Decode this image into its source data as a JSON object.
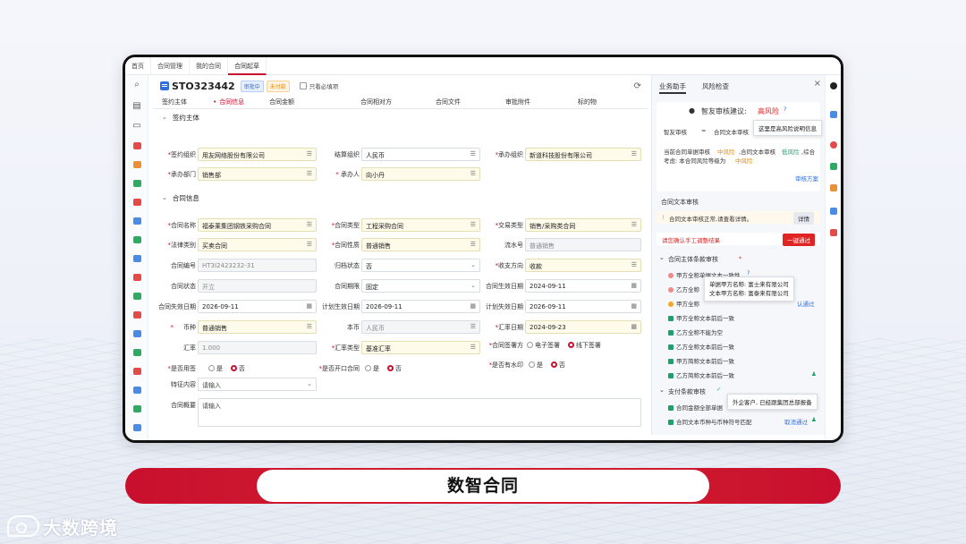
{
  "topnav": [
    "首页",
    "合同管理",
    "我的合同",
    "合同起草"
  ],
  "record": {
    "no": "STO323442",
    "badge1": "审批中",
    "badge2": "未付款",
    "only_required": "只看必填项"
  },
  "tabs": [
    "签约主体",
    "合同信息",
    "合同金额",
    "合同相对方",
    "合同文件",
    "审批附件",
    "标的物"
  ],
  "sections": {
    "party": "签约主体",
    "info": "合同信息"
  },
  "party_fields": [
    {
      "label": "签约组织",
      "value": "用友网络股份有限公司",
      "req": true
    },
    {
      "label": "结算组织",
      "value": "人民币",
      "req": false
    },
    {
      "label": "承办组织",
      "value": "新道科技股份有限公司",
      "req": true
    },
    {
      "label": "承办部门",
      "value": "销售部",
      "req": true
    },
    {
      "label": "承办人",
      "value": "向小丹",
      "req": true
    }
  ],
  "info_fields": [
    {
      "label": "合同名称",
      "value": "福泰莱集团钢铁采购合同",
      "req": true
    },
    {
      "label": "合同类型",
      "value": "工程采购合同",
      "req": true
    },
    {
      "label": "交易类型",
      "value": "销售/采购类合同",
      "req": true
    },
    {
      "label": "法律类别",
      "value": "买卖合同",
      "req": true
    },
    {
      "label": "合同性质",
      "value": "普通销售",
      "req": true
    },
    {
      "label": "流水号",
      "value": "普通销售",
      "req": false
    },
    {
      "label": "合同编号",
      "value": "HT3I2423232-31",
      "req": false
    },
    {
      "label": "归档状态",
      "value": "否",
      "req": false
    },
    {
      "label": "收支方向",
      "value": "收款",
      "req": true
    },
    {
      "label": "合同状态",
      "value": "开立",
      "req": false
    },
    {
      "label": "合同期限",
      "value": "固定",
      "req": false
    },
    {
      "label": "合同生效日期",
      "value": "2024-09-11",
      "req": false
    },
    {
      "label": "合同失效日期",
      "value": "2026-09-11",
      "req": false
    },
    {
      "label": "计划生效日期",
      "value": "2026-09-11",
      "req": false
    },
    {
      "label": "计划失效日期",
      "value": "2026-09-11",
      "req": false
    },
    {
      "label": "币种",
      "value": "普通销售",
      "req": true
    },
    {
      "label": "本币",
      "value": "人民币",
      "req": false
    },
    {
      "label": "汇率日期",
      "value": "2024-09-23",
      "req": true
    },
    {
      "label": "汇率",
      "value": "1.000",
      "req": false
    },
    {
      "label": "汇率类型",
      "value": "基准汇率",
      "req": true
    },
    {
      "label": "合同签署方",
      "value": "",
      "req": true
    },
    {
      "label": "是否用签",
      "value": "",
      "req": true
    },
    {
      "label": "是否开口合同",
      "value": "",
      "req": true
    },
    {
      "label": "是否有水印",
      "value": "",
      "req": true
    },
    {
      "label": "特征内容",
      "value": "请输入",
      "req": false
    },
    {
      "label": "合同概要",
      "value": "请输入",
      "req": false
    }
  ],
  "radios": {
    "sign_e": "电子签署",
    "sign_off": "线下签署",
    "yes": "是",
    "no": "否"
  },
  "right": {
    "tab1": "业务助手",
    "tab2": "风险检查",
    "ai_title": "智友审核建议:",
    "risk_level": "高风险",
    "review_label": "智友审核",
    "equals": "=",
    "text_review_label": "合同文本审核",
    "tooltip_reason": "这里是高风险说明信息",
    "summary_1": "当前合同单据审核",
    "summary_1_risk": "中风险",
    "summary_1b": ",合同文本审核",
    "summary_1_risk2": "低风险",
    "summary_1c": ",综合",
    "summary_2": "考虑: 本合同风险等级为",
    "summary_2_risk": "中风险",
    "review_plan": "审核方案",
    "text_section": "合同文本审核",
    "text_ok": "合同文本审核正常,请查看详情。",
    "detail_btn": "详情",
    "confirm_note": "请您确认手工调整结果",
    "pass_all_btn": "一键通过",
    "main_clause": "合同主体条款审核",
    "items": [
      "甲方全称单据文本一致性",
      "乙方全称",
      "甲方全称",
      "甲方全称文本前后一致",
      "乙方全称不能为空",
      "乙方全称文本前后一致",
      "甲方简称文本前后一致",
      "乙方简称文本前后一致"
    ],
    "tip_party_a": "单据甲方名称: 富士来有限公司",
    "tip_party_b": "文本甲方名称: 富泰来有限公司",
    "confirm_pass": "认通过",
    "pay_clause": "支付条款审核",
    "pay_items": [
      "合同金额全部单据",
      "合同文本币种与币种符号匹配"
    ],
    "tip_pay": "外企客户, 已经跟集团总部报备",
    "cancel_pass": "取消通过"
  },
  "banner": "数智合同",
  "logo": "大数跨境",
  "colors": {
    "brand_red": "#c8102e",
    "accent_blue": "#2f6fde",
    "ok_green": "#22a06b"
  }
}
